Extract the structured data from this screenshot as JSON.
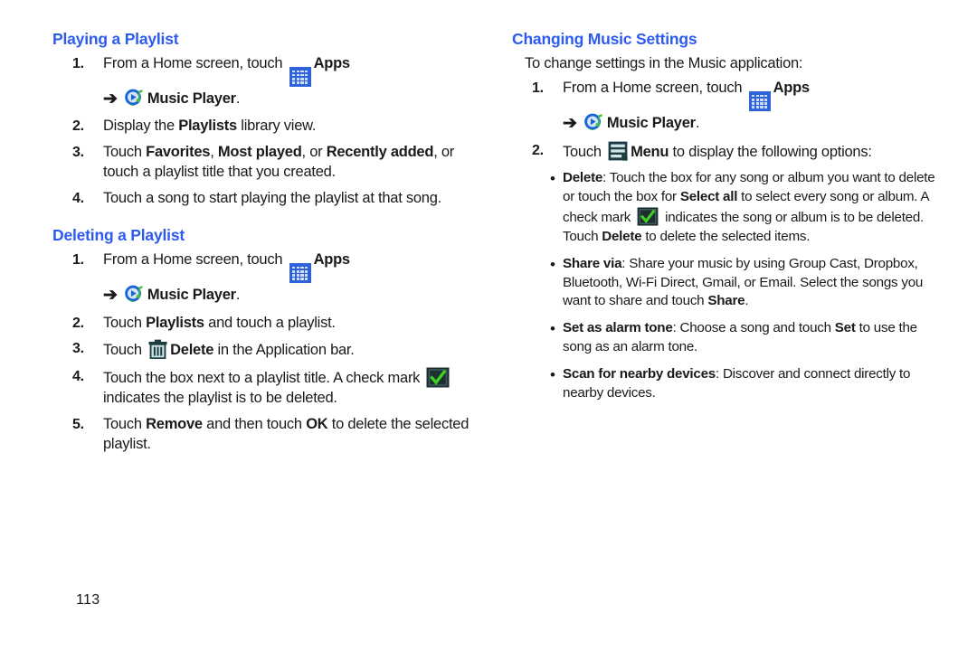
{
  "page": {
    "number": "113",
    "heading_color": "#2d5bf0"
  },
  "icons": {
    "apps": "apps-grid-icon",
    "music_player": "music-player-icon",
    "trash": "trash-delete-icon",
    "check": "green-check-box-icon",
    "menu": "menu-list-icon",
    "arrow": "➔"
  },
  "left_column": {
    "section1": {
      "heading": "Playing a Playlist",
      "steps": [
        {
          "num": "1.",
          "text_before_icon": "From a Home screen, touch ",
          "label_apps": "Apps",
          "sub_label_music": "Music Player",
          "sub_period": "."
        },
        {
          "num": "2.",
          "part1": "Display the ",
          "bold1": "Playlists",
          "part2": " library view."
        },
        {
          "num": "3.",
          "part1": "Touch ",
          "bold1": "Favorites",
          "part2": ", ",
          "bold2": "Most played",
          "part3": ", or ",
          "bold3": "Recently added",
          "part4": ", or touch a playlist title that you created."
        },
        {
          "num": "4.",
          "part1": "Touch a song to start playing the playlist at that song."
        }
      ]
    },
    "section2": {
      "heading": "Deleting a Playlist",
      "steps": [
        {
          "num": "1.",
          "text_before_icon": "From a Home screen, touch ",
          "label_apps": "Apps",
          "sub_label_music": "Music Player",
          "sub_period": "."
        },
        {
          "num": "2.",
          "part1": "Touch ",
          "bold1": "Playlists",
          "part2": " and touch a playlist."
        },
        {
          "num": "3.",
          "part1": "Touch ",
          "bold1": "Delete",
          "part2": " in the Application bar."
        },
        {
          "num": "4.",
          "part1": "Touch the box next to a playlist title. A check mark ",
          "part2": " indicates the playlist is to be deleted."
        },
        {
          "num": "5.",
          "part1": "Touch ",
          "bold1": "Remove",
          "part2": " and then touch ",
          "bold2": "OK",
          "part3": " to delete the selected playlist."
        }
      ]
    }
  },
  "right_column": {
    "heading": "Changing Music Settings",
    "intro": "To change settings in the Music application:",
    "steps": [
      {
        "num": "1.",
        "text_before_icon": "From a Home screen, touch ",
        "label_apps": "Apps",
        "sub_label_music": "Music Player",
        "sub_period": "."
      },
      {
        "num": "2.",
        "part1": "Touch ",
        "bold1": "Menu",
        "part2": " to display the following options:"
      }
    ],
    "bullets": [
      {
        "title": "Delete",
        "p1": ": Touch the box for any song or album you want to delete or touch the box for ",
        "b1": "Select all",
        "p2": " to select every song or album. A check mark ",
        "p3": " indicates the song or album is to be deleted. Touch ",
        "b2": "Delete",
        "p4": " to delete the selected items."
      },
      {
        "title": "Share via",
        "p1": ": Share your music by using Group Cast, Dropbox, Bluetooth, Wi-Fi Direct, Gmail, or Email. Select the songs you want to share and touch ",
        "b1": "Share",
        "p2": "."
      },
      {
        "title": "Set as alarm tone",
        "p1": ": Choose a song and touch ",
        "b1": "Set",
        "p2": " to use the song as an alarm tone."
      },
      {
        "title": "Scan for nearby devices",
        "p1": ": Discover and connect directly to nearby devices."
      }
    ]
  }
}
